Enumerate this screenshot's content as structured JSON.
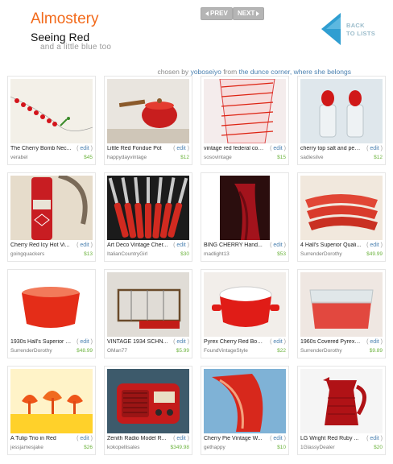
{
  "header": {
    "brand": "Almostery",
    "title": "Seeing Red",
    "subtitle": "and a little blue too",
    "prev": "PREV",
    "next": "NEXT",
    "back_line1": "BACK",
    "back_line2": "TO LISTS"
  },
  "credit": {
    "chosen_by": "chosen by",
    "curator": "yoboseiyo",
    "from": "from",
    "source": "the dunce corner, where she belongs"
  },
  "edit_label": "edit",
  "items": [
    {
      "title": "The Cherry Bomb Nec...",
      "shop": "verabel",
      "price": "$45",
      "thumb": "necklace"
    },
    {
      "title": "Little Red Fondue Pot",
      "shop": "happydayvintage",
      "price": "$12",
      "thumb": "fondue"
    },
    {
      "title": "vintage red federal cockt...",
      "shop": "sosovintage",
      "price": "$15",
      "thumb": "glass"
    },
    {
      "title": "cherry top salt and pep...",
      "shop": "sadiesilve",
      "price": "$12",
      "thumb": "shakers"
    },
    {
      "title": "Cherry Red Icy Hot Vi...",
      "shop": "goingquackers",
      "price": "$13",
      "thumb": "thermos"
    },
    {
      "title": "Art Deco Vintage Cher...",
      "shop": "ItalianCountryGirl",
      "price": "$30",
      "thumb": "knives"
    },
    {
      "title": "BING CHERRY Hand...",
      "shop": "madlight13",
      "price": "$53",
      "thumb": "scarf"
    },
    {
      "title": "4 Hall's Superior Quali...",
      "shop": "SurrenderDorothy",
      "price": "$49.99",
      "thumb": "plates"
    },
    {
      "title": "1930s Hall's Superior Qu...",
      "shop": "SurrenderDorothy",
      "price": "$48.99",
      "thumb": "bowl"
    },
    {
      "title": "VINTAGE 1934 SCHN...",
      "shop": "OMan77",
      "price": "$5.99",
      "thumb": "tool"
    },
    {
      "title": "Pyrex Cherry Red Bow...",
      "shop": "FoundVintageStyle",
      "price": "$22",
      "thumb": "pyrexbowl"
    },
    {
      "title": "1960s Covered Pyrex Fr...",
      "shop": "SurrenderDorothy",
      "price": "$9.89",
      "thumb": "pyrexdish"
    },
    {
      "title": "A Tulip Trio in Red",
      "shop": "jessjamesjake",
      "price": "$26",
      "thumb": "tulips"
    },
    {
      "title": "Zenith Radio Model R...",
      "shop": "kokopellisales",
      "price": "$349.98",
      "thumb": "radio"
    },
    {
      "title": "Cherry Pie Vintage W...",
      "shop": "gethappy",
      "price": "$10",
      "thumb": "chair"
    },
    {
      "title": "LG Wright Red Ruby ...",
      "shop": "1GlassyDealer",
      "price": "$20",
      "thumb": "pitcher"
    }
  ]
}
